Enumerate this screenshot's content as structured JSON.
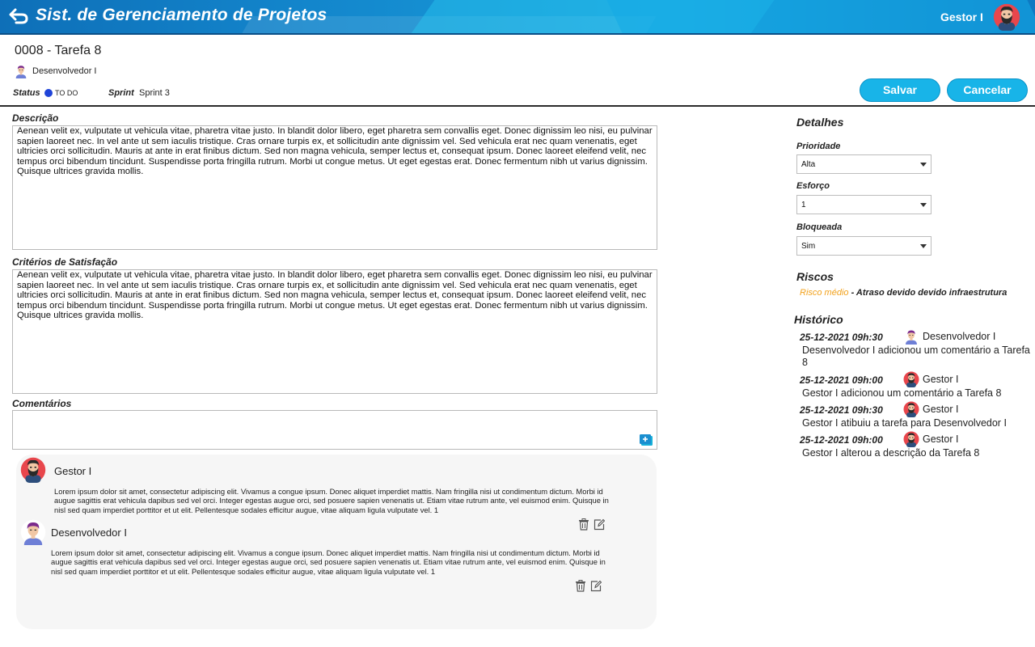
{
  "header": {
    "app_title": "Sist. de Gerenciamento de Projetos",
    "user_name": "Gestor I"
  },
  "task": {
    "title": "0008 - Tarefa 8",
    "assignee": "Desenvolvedor I",
    "status_label": "Status",
    "status_value": "TO DO",
    "status_color": "#1f44d8",
    "sprint_label": "Sprint",
    "sprint_value": "Sprint 3"
  },
  "actions": {
    "save_label": "Salvar",
    "cancel_label": "Cancelar"
  },
  "description": {
    "label": "Descrição",
    "text": "Aenean velit ex, vulputate ut vehicula vitae, pharetra vitae justo. In blandit dolor libero, eget pharetra sem convallis eget. Donec dignissim leo nisi, eu pulvinar sapien laoreet nec. In vel ante ut sem iaculis tristique. Cras ornare turpis ex, et sollicitudin ante dignissim vel. Sed vehicula erat nec quam venenatis, eget ultricies orci sollicitudin. Mauris at ante in erat finibus dictum. Sed non magna vehicula, semper lectus et, consequat ipsum. Donec laoreet eleifend velit, nec tempus orci bibendum tincidunt. Suspendisse porta fringilla rutrum. Morbi ut congue metus. Ut eget egestas erat. Donec fermentum nibh ut varius dignissim. Quisque ultrices gravida mollis."
  },
  "criteria": {
    "label": "Critérios de Satisfação",
    "text": "Aenean velit ex, vulputate ut vehicula vitae, pharetra vitae justo. In blandit dolor libero, eget pharetra sem convallis eget. Donec dignissim leo nisi, eu pulvinar sapien laoreet nec. In vel ante ut sem iaculis tristique. Cras ornare turpis ex, et sollicitudin ante dignissim vel. Sed vehicula erat nec quam venenatis, eget ultricies orci sollicitudin. Mauris at ante in erat finibus dictum. Sed non magna vehicula, semper lectus et, consequat ipsum. Donec laoreet eleifend velit, nec tempus orci bibendum tincidunt. Suspendisse porta fringilla rutrum. Morbi ut congue metus. Ut eget egestas erat. Donec fermentum nibh ut varius dignissim. Quisque ultrices gravida mollis."
  },
  "comments": {
    "label": "Comentários",
    "input_value": "",
    "items": [
      {
        "author": "Gestor I",
        "text": "Lorem ipsum dolor sit amet, consectetur adipiscing elit. Vivamus a congue ipsum. Donec aliquet imperdiet mattis. Nam fringilla nisi ut condimentum dictum. Morbi id augue sagittis erat vehicula dapibus sed vel orci. Integer egestas augue orci, sed posuere sapien venenatis ut. Etiam vitae rutrum ante, vel euismod enim. Quisque in nisl sed quam imperdiet porttitor et ut elit. Pellentesque sodales efficitur augue, vitae aliquam ligula vulputate vel. 1"
      },
      {
        "author": "Desenvolvedor I",
        "text": "Lorem ipsum dolor sit amet, consectetur adipiscing elit. Vivamus a congue ipsum. Donec aliquet imperdiet mattis. Nam fringilla nisi ut condimentum dictum. Morbi id augue sagittis erat vehicula dapibus sed vel orci. Integer egestas augue orci, sed posuere sapien venenatis ut. Etiam vitae rutrum ante, vel euismod enim. Quisque in nisl sed quam imperdiet porttitor et ut elit. Pellentesque sodales efficitur augue, vitae aliquam ligula vulputate vel. 1"
      }
    ]
  },
  "details": {
    "title": "Detalhes",
    "priority_label": "Prioridade",
    "priority_value": "Alta",
    "effort_label": "Esforço",
    "effort_value": "1",
    "blocked_label": "Bloqueada",
    "blocked_value": "Sim"
  },
  "risks": {
    "title": "Riscos",
    "level": "Risco médio",
    "description": " - Atraso devido devido infraestrutura",
    "level_color": "#f2a11a"
  },
  "history": {
    "title": "Histórico",
    "items": [
      {
        "date": "25-12-2021 09h:30",
        "user": "Desenvolvedor I",
        "action": "Desenvolvedor I adicionou um comentário a Tarefa 8"
      },
      {
        "date": "25-12-2021 09h:00",
        "user": "Gestor I",
        "action": "Gestor I adicionou um comentário a Tarefa 8"
      },
      {
        "date": "25-12-2021 09h:30",
        "user": "Gestor I",
        "action": "Gestor I atibuiu a tarefa para Desenvolvedor I"
      },
      {
        "date": "25-12-2021 09h:00",
        "user": "Gestor I",
        "action": "Gestor I alterou a descrição da Tarefa 8"
      }
    ]
  },
  "icons": {
    "back": "back-arrow-icon",
    "avatar_manager": "bearded-man-avatar-icon",
    "avatar_developer": "developer-avatar-icon",
    "add_comment": "add-comment-icon",
    "delete": "trash-icon",
    "edit": "edit-icon",
    "dropdown": "chevron-down-icon"
  }
}
